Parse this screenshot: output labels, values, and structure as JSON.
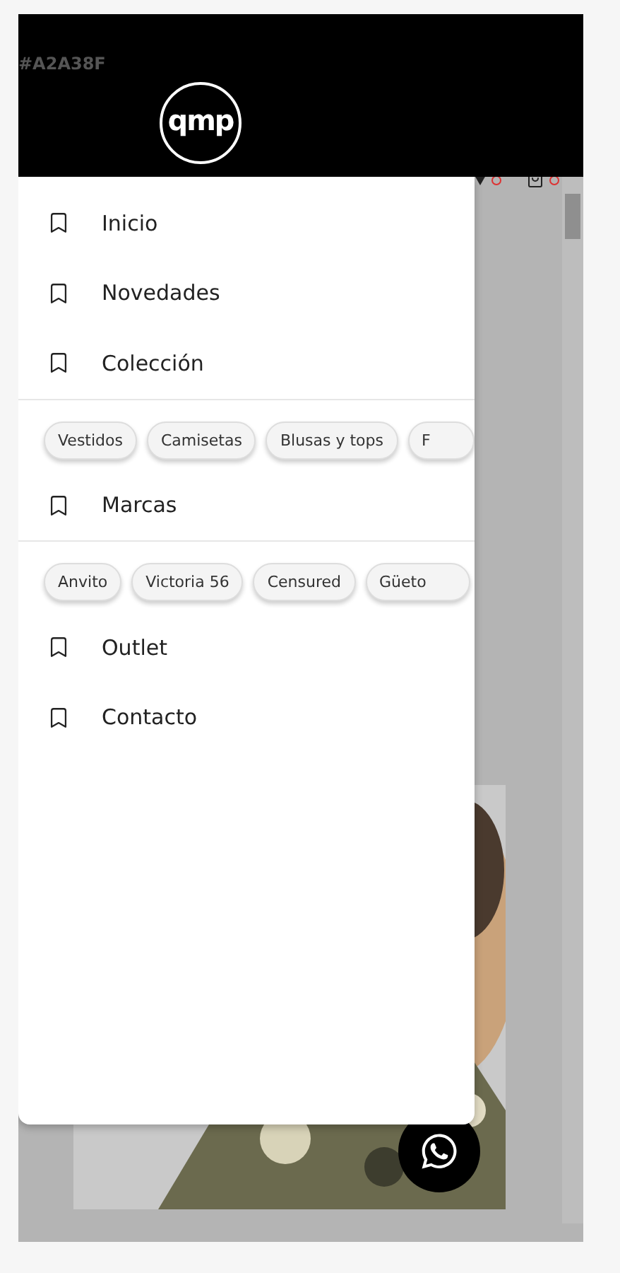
{
  "header": {
    "color_code": "#A2A38F",
    "logo": "qmp"
  },
  "menu": [
    {
      "kind": "link",
      "label": "Inicio"
    },
    {
      "kind": "link",
      "label": "Novedades"
    },
    {
      "kind": "link",
      "label": "Colección"
    },
    {
      "kind": "chips",
      "chips": [
        "Vestidos",
        "Camisetas",
        "Blusas y tops",
        "F"
      ]
    },
    {
      "kind": "link",
      "label": "Marcas"
    },
    {
      "kind": "chips",
      "chips": [
        "Anvito",
        "Victoria 56",
        "Censured",
        "Güeto"
      ]
    },
    {
      "kind": "link",
      "label": "Outlet"
    },
    {
      "kind": "link",
      "label": "Contacto"
    }
  ]
}
